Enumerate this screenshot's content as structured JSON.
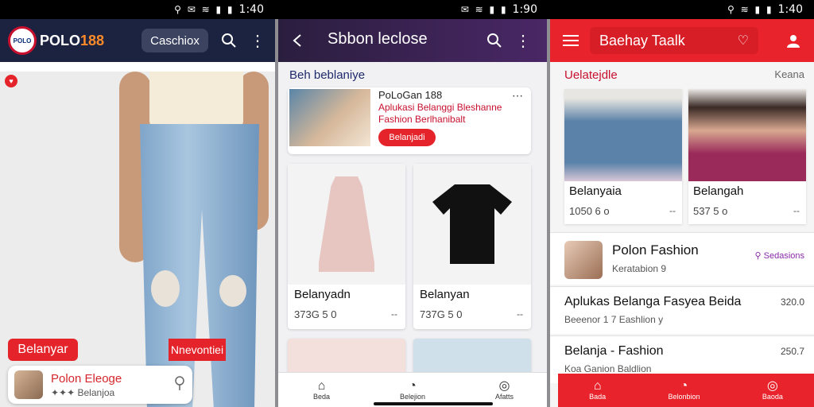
{
  "screens": [
    {
      "status": {
        "icons": "⚲ ✉ ≋ ▮ ▮",
        "time": "1:40"
      },
      "appbar": {
        "logo_badge": "POLO",
        "logo_text": "POLO",
        "logo_num": "188",
        "chip": "Caschiox"
      },
      "hero": {
        "badge": "♥",
        "buy_button": "Belanyar",
        "tag_button": "Nnevontiei"
      },
      "mini_card": {
        "title": "Polon Eleoge",
        "sub": "✦✦✦ Belanjoa"
      }
    },
    {
      "status": {
        "icons": "✉ ≋ ▮ ▮",
        "time": "1:90"
      },
      "appbar": {
        "title": "Sbbon leclose"
      },
      "section_heading": "Beh beblaniye",
      "promo": {
        "line1": "PoLoGan 188",
        "line2": "Aplukasi Belanggi Bleshanne",
        "line3": "Fashion Berlhanibalt",
        "button": "Belanjadi",
        "more": "⋯"
      },
      "products": [
        {
          "name": "Belanyadn",
          "price": "373G 5 0",
          "more": "--"
        },
        {
          "name": "Belanyan",
          "price": "737G 5 0",
          "more": "--"
        }
      ],
      "nav": [
        {
          "label": "Beda",
          "icon": "⌂"
        },
        {
          "label": "Belejion",
          "icon": "◔"
        },
        {
          "label": "Afatts",
          "icon": "◎"
        }
      ]
    },
    {
      "status": {
        "icons": "⚲ ≋ ▮ ▮",
        "time": "1:40"
      },
      "appbar": {
        "search_text": "Baehay Taalk",
        "search_icon": "♡"
      },
      "section": {
        "title": "Uelatejdle",
        "more": "Keana"
      },
      "models": [
        {
          "name": "Belanyaia",
          "price": "1050 6 o",
          "more": "--"
        },
        {
          "name": "Belangah",
          "price": "537 5 o",
          "more": "--"
        }
      ],
      "store": {
        "name": "Polon Fashion",
        "sub": "Keratabion 9",
        "badge": "⚲ Sedasions"
      },
      "rows": [
        {
          "title": "Aplukas Belanga Fasyea Beida",
          "sub": "Beeenor 1 7 Eashlion y",
          "price": "320.0"
        },
        {
          "title": "Belanja - Fashion",
          "sub": "Koa Ganion Baldlion",
          "price": "250.7"
        }
      ],
      "nav": [
        {
          "label": "Bada",
          "icon": "⌂"
        },
        {
          "label": "Belonbion",
          "icon": "◔"
        },
        {
          "label": "Baoda",
          "icon": "◎"
        }
      ]
    }
  ]
}
